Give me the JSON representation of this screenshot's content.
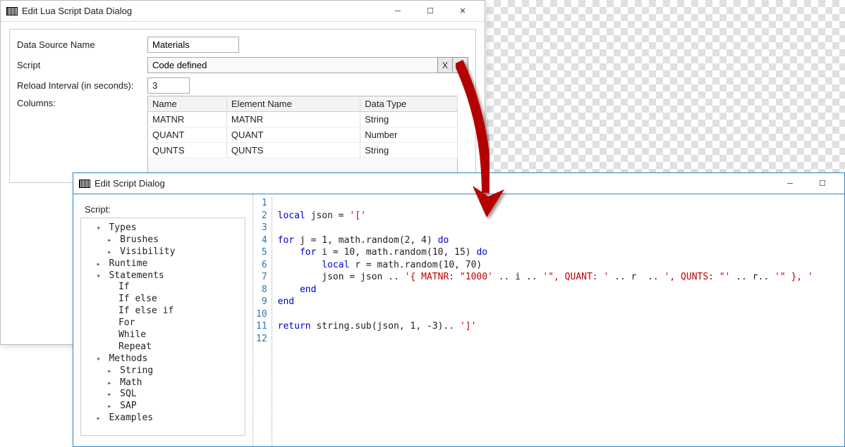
{
  "dialog1": {
    "title": "Edit Lua Script Data Dialog",
    "fields": {
      "dsname_label": "Data Source Name",
      "dsname_value": "Materials",
      "script_label": "Script",
      "script_value": "Code defined",
      "btn_x": "X",
      "btn_c": "C",
      "reload_label": "Reload Interval (in seconds):",
      "reload_value": "3",
      "columns_label": "Columns:"
    },
    "table": {
      "headers": [
        "Name",
        "Element Name",
        "Data Type"
      ],
      "rows": [
        [
          "MATNR",
          "MATNR",
          "String"
        ],
        [
          "QUANT",
          "QUANT",
          "Number"
        ],
        [
          "QUNTS",
          "QUNTS",
          "String"
        ]
      ]
    }
  },
  "dialog2": {
    "title": "Edit Script Dialog",
    "script_label": "Script:",
    "tree": [
      {
        "d": 0,
        "open": true,
        "label": "Types"
      },
      {
        "d": 1,
        "open": false,
        "label": "Brushes"
      },
      {
        "d": 1,
        "open": false,
        "label": "Visibility"
      },
      {
        "d": 0,
        "open": false,
        "label": "Runtime"
      },
      {
        "d": 0,
        "open": true,
        "label": "Statements"
      },
      {
        "d": 1,
        "leaf": true,
        "label": "If"
      },
      {
        "d": 1,
        "leaf": true,
        "label": "If else"
      },
      {
        "d": 1,
        "leaf": true,
        "label": "If else if"
      },
      {
        "d": 1,
        "leaf": true,
        "label": "For"
      },
      {
        "d": 1,
        "leaf": true,
        "label": "While"
      },
      {
        "d": 1,
        "leaf": true,
        "label": "Repeat"
      },
      {
        "d": 0,
        "open": true,
        "label": "Methods"
      },
      {
        "d": 1,
        "open": false,
        "label": "String"
      },
      {
        "d": 1,
        "open": false,
        "label": "Math"
      },
      {
        "d": 1,
        "open": false,
        "label": "SQL"
      },
      {
        "d": 1,
        "open": false,
        "label": "SAP"
      },
      {
        "d": 0,
        "open": false,
        "label": "Examples"
      }
    ],
    "code": {
      "lines": 12,
      "l1": "",
      "l2": {
        "a": "local",
        "b": " json = ",
        "c": "'['"
      },
      "l3": "",
      "l4": {
        "a": "for",
        "b": " j = 1, math.random(2, 4) ",
        "c": "do"
      },
      "l5": {
        "a": "    for",
        "b": " i = 10, math.random(10, 15) ",
        "c": "do"
      },
      "l6": {
        "a": "        local",
        "b": " r = math.random(10, 70)"
      },
      "l7": {
        "a": "        json = json .. ",
        "s1": "'{ MATNR: \"1000'",
        "b": " .. i .. ",
        "s2": "'\", QUANT: '",
        "c": " .. r  .. ",
        "s3": "', QUNTS: \"'",
        "d": " .. r.. ",
        "s4": "'\" }, '"
      },
      "l8": {
        "a": "    end"
      },
      "l9": {
        "a": "end"
      },
      "l10": "",
      "l11": {
        "a": "return",
        "b": " string.sub(json, 1, -3).. ",
        "c": "']'"
      },
      "l12": ""
    }
  }
}
